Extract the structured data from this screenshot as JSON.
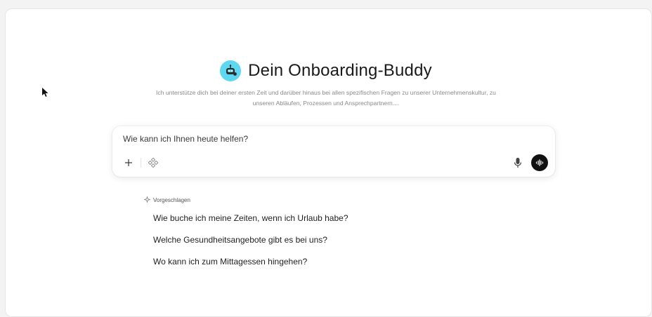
{
  "header": {
    "title": "Dein Onboarding-Buddy",
    "subtitle": "Ich unterstütze dich bei deiner ersten Zeit und darüber hinaus bei allen spezifischen Fragen zu unserer Unternehmenskultur, zu unseren Abläufen, Prozessen und Ansprechpartnern....",
    "logo_icon": "robot-icon",
    "logo_color": "#5ed8f0"
  },
  "composer": {
    "placeholder": "Wie kann ich Ihnen heute helfen?",
    "value": "",
    "add_icon": "plus-icon",
    "tools_icon": "tools-icon",
    "mic_icon": "microphone-icon",
    "voice_icon": "voice-mode-icon"
  },
  "suggestions": {
    "header_label": "Vorgeschlagen",
    "header_icon": "sparkle-icon",
    "items": [
      "Wie buche ich meine Zeiten, wenn ich Urlaub habe?",
      "Welche Gesundheitsangebote gibt es bei uns?",
      "Wo kann ich zum Mittagessen hingehen?"
    ]
  },
  "colors": {
    "accent": "#5ed8f0",
    "voice_button": "#111111"
  }
}
